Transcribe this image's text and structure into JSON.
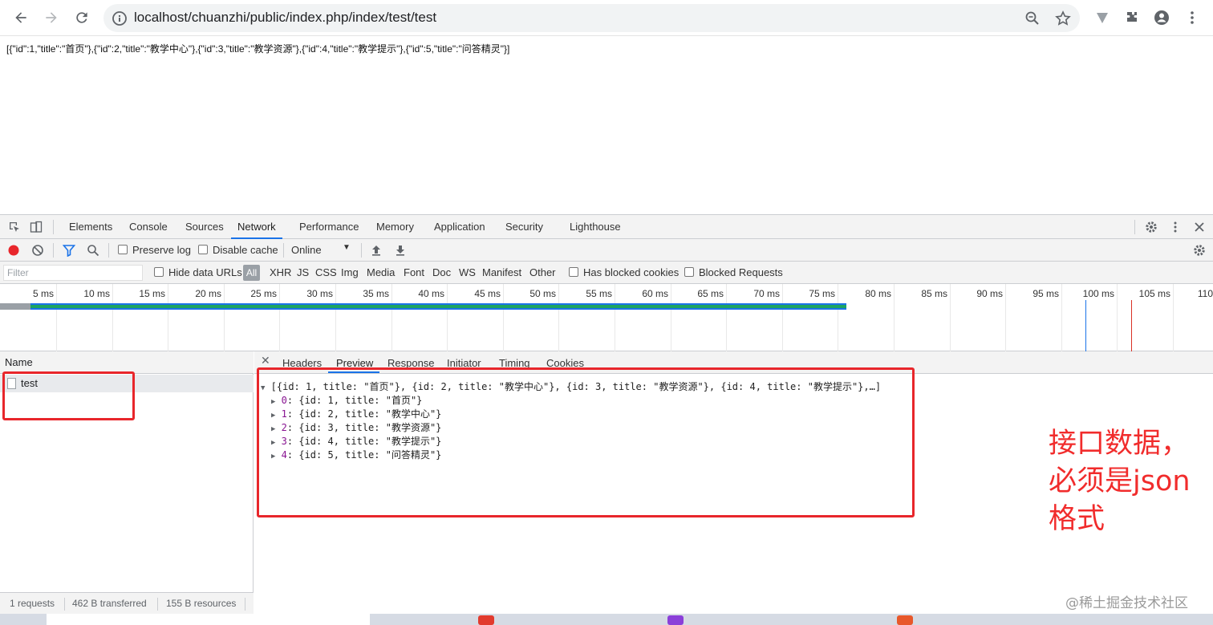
{
  "browser": {
    "url": "localhost/chuanzhi/public/index.php/index/test/test",
    "icons": [
      "back-arrow-icon",
      "forward-arrow-icon",
      "reload-icon",
      "info-icon",
      "zoom-icon",
      "star-icon",
      "vpn-icon",
      "extensions-icon",
      "profile-icon",
      "menu-dots-icon"
    ]
  },
  "page": {
    "json_text": "[{\"id\":1,\"title\":\"首页\"},{\"id\":2,\"title\":\"教学中心\"},{\"id\":3,\"title\":\"教学资源\"},{\"id\":4,\"title\":\"教学提示\"},{\"id\":5,\"title\":\"问答精灵\"}]"
  },
  "devtools": {
    "tabs": [
      "Elements",
      "Console",
      "Sources",
      "Network",
      "Performance",
      "Memory",
      "Application",
      "Security",
      "Lighthouse"
    ],
    "active_tab": "Network",
    "toolbar": {
      "preserve_log": "Preserve log",
      "disable_cache": "Disable cache",
      "throttling": "Online"
    },
    "filter": {
      "placeholder": "Filter",
      "hide_data_urls": "Hide data URLs",
      "all": "All",
      "types": [
        "XHR",
        "JS",
        "CSS",
        "Img",
        "Media",
        "Font",
        "Doc",
        "WS",
        "Manifest",
        "Other"
      ],
      "has_blocked_cookies": "Has blocked cookies",
      "blocked_requests": "Blocked Requests"
    },
    "timeline": {
      "ticks": [
        "5 ms",
        "10 ms",
        "15 ms",
        "20 ms",
        "25 ms",
        "30 ms",
        "35 ms",
        "40 ms",
        "45 ms",
        "50 ms",
        "55 ms",
        "60 ms",
        "65 ms",
        "70 ms",
        "75 ms",
        "80 ms",
        "85 ms",
        "90 ms",
        "95 ms",
        "100 ms",
        "105 ms",
        "110"
      ]
    },
    "requests": {
      "header": "Name",
      "items": [
        "test"
      ],
      "status": [
        "1 requests",
        "462 B transferred",
        "155 B resources"
      ]
    },
    "detail": {
      "tabs": [
        "Headers",
        "Preview",
        "Response",
        "Initiator",
        "Timing",
        "Cookies"
      ],
      "active_tab": "Preview",
      "summary": "[{id: 1, title: \"首页\"}, {id: 2, title: \"教学中心\"}, {id: 3, title: \"教学资源\"}, {id: 4, title: \"教学提示\"},…]",
      "rows": [
        {
          "index": "0",
          "text": "{id: 1, title: \"首页\"}"
        },
        {
          "index": "1",
          "text": "{id: 2, title: \"教学中心\"}"
        },
        {
          "index": "2",
          "text": "{id: 3, title: \"教学资源\"}"
        },
        {
          "index": "3",
          "text": "{id: 4, title: \"教学提示\"}"
        },
        {
          "index": "4",
          "text": "{id: 5, title: \"问答精灵\"}"
        }
      ]
    }
  },
  "annotation": {
    "lines": [
      "接口数据，",
      "必须是json",
      "格式"
    ],
    "color": "#f12c2c"
  },
  "watermark": "@稀土掘金技术社区"
}
